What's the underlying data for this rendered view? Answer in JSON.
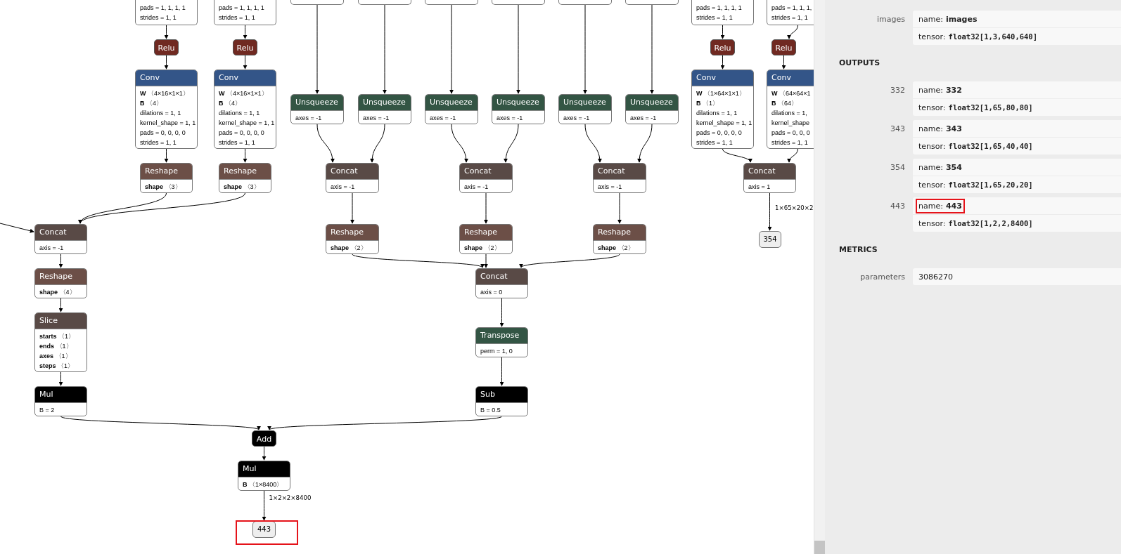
{
  "graph": {
    "nodes": [
      {
        "kind": "fragment",
        "attrs": [
          "pads = 1, 1, 1, 1",
          "strides = 1, 1"
        ]
      },
      {
        "kind": "fragment",
        "attrs": [
          "pads = 1, 1, 1, 1",
          "strides = 1, 1"
        ]
      },
      {
        "kind": "activation",
        "title": "Relu"
      },
      {
        "kind": "activation",
        "title": "Relu"
      },
      {
        "kind": "layer",
        "title": "Conv",
        "attrs": [
          "**W** 〈4×16×1×1〉",
          "**B** 〈4〉",
          "dilations = 1, 1",
          "kernel_shape = 1, 1",
          "pads = 0, 0, 0, 0",
          "strides = 1, 1"
        ]
      },
      {
        "kind": "layer",
        "title": "Conv",
        "attrs": [
          "**W** 〈4×16×1×1〉",
          "**B** 〈4〉",
          "dilations = 1, 1",
          "kernel_shape = 1, 1",
          "pads = 0, 0, 0, 0",
          "strides = 1, 1"
        ]
      },
      {
        "kind": "shape",
        "title": "Reshape",
        "attrs": [
          "**shape** 〈3〉"
        ]
      },
      {
        "kind": "shape",
        "title": "Reshape",
        "attrs": [
          "**shape** 〈3〉"
        ]
      },
      {
        "kind": "tensor",
        "title": "Concat",
        "attrs": [
          "axis = -1"
        ]
      },
      {
        "kind": "shape",
        "title": "Reshape",
        "attrs": [
          "**shape** 〈4〉"
        ]
      },
      {
        "kind": "tensor",
        "title": "Slice",
        "attrs": [
          "**starts** 〈1〉",
          "**ends** 〈1〉",
          "**axes** 〈1〉",
          "**steps** 〈1〉"
        ]
      },
      {
        "kind": "math",
        "title": "Mul",
        "attrs": [
          "B = 2"
        ]
      },
      {
        "kind": "math",
        "title": "Add"
      },
      {
        "kind": "math",
        "title": "Mul",
        "attrs": [
          "**B** 〈1×8400〉"
        ]
      },
      {
        "kind": "output",
        "title": "443",
        "edge_label": "1×2×2×8400",
        "highlighted": true
      },
      {
        "kind": "fragment"
      },
      {
        "kind": "fragment"
      },
      {
        "kind": "fragment"
      },
      {
        "kind": "fragment"
      },
      {
        "kind": "fragment"
      },
      {
        "kind": "fragment"
      },
      {
        "kind": "transform",
        "title": "Unsqueeze",
        "attrs": [
          "axes = -1"
        ]
      },
      {
        "kind": "transform",
        "title": "Unsqueeze",
        "attrs": [
          "axes = -1"
        ]
      },
      {
        "kind": "transform",
        "title": "Unsqueeze",
        "attrs": [
          "axes = -1"
        ]
      },
      {
        "kind": "transform",
        "title": "Unsqueeze",
        "attrs": [
          "axes = -1"
        ]
      },
      {
        "kind": "transform",
        "title": "Unsqueeze",
        "attrs": [
          "axes = -1"
        ]
      },
      {
        "kind": "transform",
        "title": "Unsqueeze",
        "attrs": [
          "axes = -1"
        ]
      },
      {
        "kind": "tensor",
        "title": "Concat",
        "attrs": [
          "axis = -1"
        ]
      },
      {
        "kind": "tensor",
        "title": "Concat",
        "attrs": [
          "axis = -1"
        ]
      },
      {
        "kind": "tensor",
        "title": "Concat",
        "attrs": [
          "axis = -1"
        ]
      },
      {
        "kind": "shape",
        "title": "Reshape",
        "attrs": [
          "**shape** 〈2〉"
        ]
      },
      {
        "kind": "shape",
        "title": "Reshape",
        "attrs": [
          "**shape** 〈2〉"
        ]
      },
      {
        "kind": "shape",
        "title": "Reshape",
        "attrs": [
          "**shape** 〈2〉"
        ]
      },
      {
        "kind": "tensor",
        "title": "Concat",
        "attrs": [
          "axis = 0"
        ]
      },
      {
        "kind": "transform",
        "title": "Transpose",
        "attrs": [
          "perm = 1, 0"
        ]
      },
      {
        "kind": "math",
        "title": "Sub",
        "attrs": [
          "B = 0.5"
        ]
      },
      {
        "kind": "fragment",
        "attrs": [
          "pads = 1, 1, 1, 1",
          "strides = 1, 1"
        ]
      },
      {
        "kind": "fragment",
        "attrs": [
          "pads = 1, 1, 1,",
          "strides = 1, 1"
        ]
      },
      {
        "kind": "activation",
        "title": "Relu"
      },
      {
        "kind": "activation",
        "title": "Relu"
      },
      {
        "kind": "layer",
        "title": "Conv",
        "attrs": [
          "**W** 〈1×64×1×1〉",
          "**B** 〈1〉",
          "dilations = 1, 1",
          "kernel_shape = 1, 1",
          "pads = 0, 0, 0, 0",
          "strides = 1, 1"
        ]
      },
      {
        "kind": "layer",
        "title": "Conv",
        "attrs": [
          "**W** 〈64×64×1",
          "**B** 〈64〉",
          "dilations = 1,",
          "kernel_shape",
          "pads = 0, 0, 0",
          "strides = 1, 1"
        ]
      },
      {
        "kind": "tensor",
        "title": "Concat",
        "attrs": [
          "axis = 1"
        ]
      },
      {
        "kind": "output",
        "title": "354",
        "edge_label": "1×65×20×2",
        "highlighted": false
      }
    ]
  },
  "panel": {
    "sections": [
      {
        "items": [
          {
            "label": "images",
            "rows": [
              {
                "kind": "name",
                "key": "name:",
                "value": "images",
                "highlighted": false
              },
              {
                "kind": "type",
                "key": "tensor:",
                "value": "float32[1,3,640,640]",
                "highlighted": false
              }
            ]
          }
        ]
      },
      {
        "heading": "OUTPUTS",
        "items": [
          {
            "label": "332",
            "rows": [
              {
                "kind": "name",
                "key": "name:",
                "value": "332",
                "highlighted": false
              },
              {
                "kind": "type",
                "key": "tensor:",
                "value": "float32[1,65,80,80]",
                "highlighted": false
              }
            ]
          },
          {
            "label": "343",
            "rows": [
              {
                "kind": "name",
                "key": "name:",
                "value": "343",
                "highlighted": false
              },
              {
                "kind": "type",
                "key": "tensor:",
                "value": "float32[1,65,40,40]",
                "highlighted": false
              }
            ]
          },
          {
            "label": "354",
            "rows": [
              {
                "kind": "name",
                "key": "name:",
                "value": "354",
                "highlighted": false
              },
              {
                "kind": "type",
                "key": "tensor:",
                "value": "float32[1,65,20,20]",
                "highlighted": false
              }
            ]
          },
          {
            "label": "443",
            "rows": [
              {
                "kind": "name",
                "key": "name:",
                "value": "443",
                "highlighted": true
              },
              {
                "kind": "type",
                "key": "tensor:",
                "value": "float32[1,2,2,8400]",
                "highlighted": false
              }
            ]
          }
        ]
      },
      {
        "heading": "METRICS",
        "items": [
          {
            "label": "parameters",
            "rows": [
              {
                "kind": "plain",
                "value": "3086270",
                "highlighted": false
              }
            ]
          }
        ]
      }
    ]
  }
}
